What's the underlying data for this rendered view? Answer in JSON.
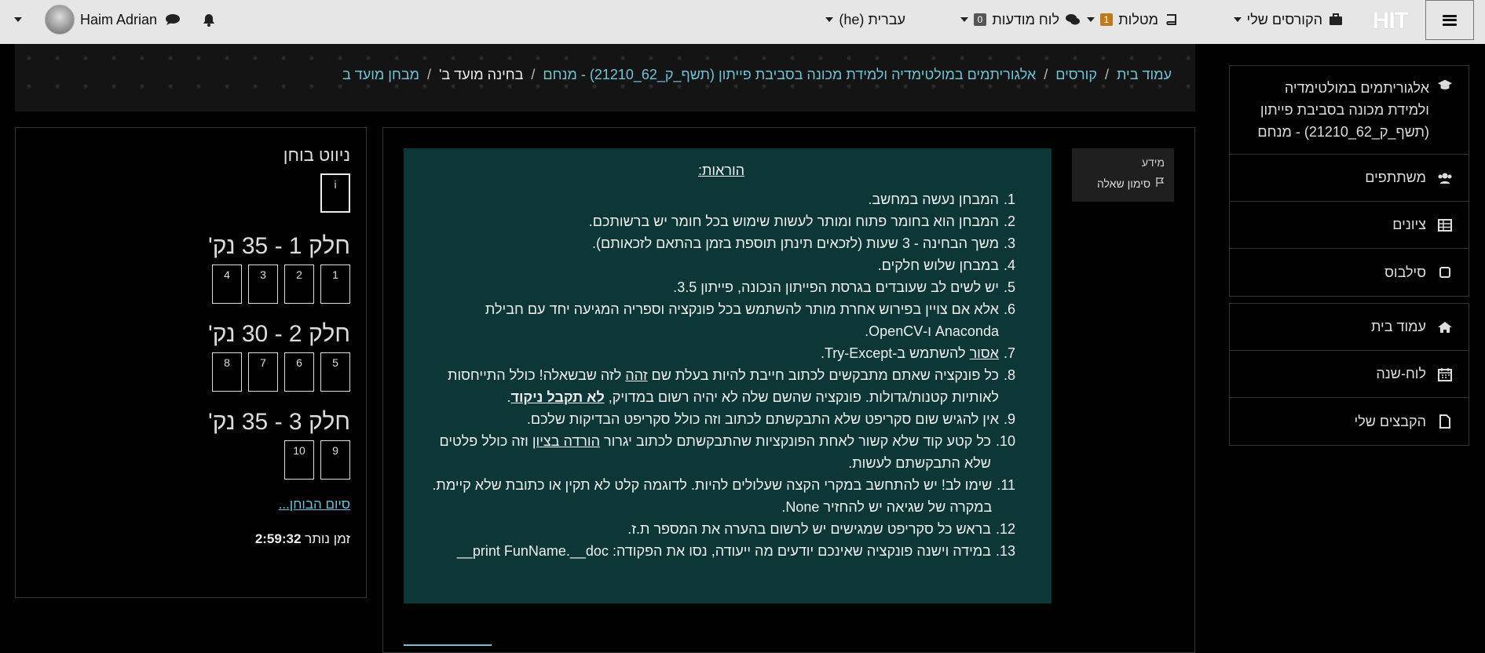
{
  "navbar": {
    "logo": "HIT",
    "my_courses": "הקורסים שלי",
    "tasks": "מטלות",
    "tasks_badge": "1",
    "messages": "לוח מודעות",
    "messages_badge": "0",
    "language": "עברית (he)",
    "user_name": "Haim Adrian"
  },
  "breadcrumb": {
    "home": "עמוד בית",
    "courses": "קורסים",
    "course": "אלגוריתמים במולטימדיה ולמידת מכונה בסביבת פייתון (תשף_ק_62_21210) - מנחם",
    "exam": "בחינה מועד ב'",
    "current": "מבחן מועד ב"
  },
  "drawer": {
    "course_title": "אלגוריתמים במולטימדיה ולמידת מכונה בסביבת פייתון (תשף_ק_62_21210) - מנחם",
    "participants": "משתתפים",
    "grades": "ציונים",
    "syllabus": "סילבוס",
    "home": "עמוד בית",
    "calendar": "לוח-שנה",
    "files": "הקבצים שלי"
  },
  "info": {
    "label": "מידע",
    "flag": "סימון שאלה"
  },
  "question": {
    "heading": "הוראות:",
    "items": [
      {
        "n": "1.",
        "t": "המבחן נעשה במחשב."
      },
      {
        "n": "2.",
        "t": "המבחן הוא בחומר פתוח ומותר לעשות שימוש בכל חומר יש ברשותכם."
      },
      {
        "n": "3.",
        "t": "משך הבחינה - 3 שעות (לזכאים תינתן תוספת בזמן בהתאם לזכאותם)."
      },
      {
        "n": "4.",
        "t": "במבחן שלוש חלקים."
      },
      {
        "n": "5.",
        "t": "יש לשים לב שעובדים בגרסת הפייתון הנכונה, פייתון 3.5."
      },
      {
        "n": "6.",
        "t": "אלא אם צויין בפירוש אחרת מותר להשתמש בכל פונקציה וספריה המגיעה יחד עם חבילת Anaconda ו-OpenCV."
      },
      {
        "n": "8.",
        "t": ""
      },
      {
        "n": "9.",
        "t": "אין להגיש שום סקריפט שלא התבקשתם לכתוב וזה כולל סקריפט הבדיקות שלכם."
      },
      {
        "n": "10.",
        "t": ""
      },
      {
        "n": "11.",
        "t": "שימו לב! יש להתחשב במקרי הקצה שעלולים להיות. לדוגמה קלט לא תקין או כתובת שלא קיימת. במקרה של שגיאה יש להחזיר None."
      },
      {
        "n": "12.",
        "t": "בראש כל סקריפט שמגישים יש לרשום בהערה את המספר ת.ז."
      },
      {
        "n": "13.",
        "t": "במידה וישנה פונקציה שאינכם יודעים מה ייעודה, נסו את הפקודה: print FunName.__doc__"
      }
    ],
    "item7": {
      "n": "7.",
      "pre": "",
      "u": "אסור",
      "post": " להשתמש ב-Try-Except."
    },
    "item8": {
      "pre": "כל פונקציה שאתם מתבקשים לכתוב חייבת להיות בעלת שם ",
      "u": "זהה",
      "mid": " לזה שבשאלה! כולל התייחסות לאותיות קטנות/גדולות. פונקציה שהשם שלה לא יהיה רשום במדויק, ",
      "ub": "לא תקבל ניקוד",
      "post": "."
    },
    "item10": {
      "pre": "כל קטע קוד שלא קשור לאחת הפונקציות שהתבקשתם לכתוב יגרור ",
      "u": "הורדה בציון",
      "post": " וזה כולל פלטים שלא התבקשתם לעשות."
    }
  },
  "quiz_nav": {
    "title": "ניווט בוחן",
    "info_cell": "i",
    "sections": [
      {
        "title": "חלק 1 - 35 נק'",
        "cells": [
          "1",
          "2",
          "3",
          "4"
        ]
      },
      {
        "title": "חלק 2 - 30 נק'",
        "cells": [
          "5",
          "6",
          "7",
          "8"
        ]
      },
      {
        "title": "חלק 3 - 35 נק'",
        "cells": [
          "9",
          "10"
        ]
      }
    ],
    "finish": "סיום הבוחן...",
    "time_label": "זמן נותר",
    "time_value": "2:59:32"
  }
}
